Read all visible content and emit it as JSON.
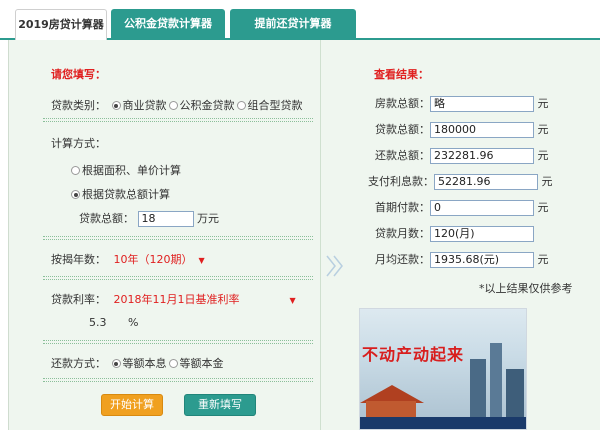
{
  "tabs": [
    {
      "label": "2019房贷计算器",
      "active": true
    },
    {
      "label": "公积金贷款计算器",
      "active": false
    },
    {
      "label": "提前还贷计算器",
      "active": false
    }
  ],
  "form": {
    "heading": "请您填写：",
    "loan_type_label": "贷款类别：",
    "loan_types": [
      "商业贷款",
      "公积金贷款",
      "组合型贷款"
    ],
    "loan_type_selected": "商业贷款",
    "calc_method_label": "计算方式：",
    "calc_options": [
      "根据面积、单价计算",
      "根据贷款总额计算"
    ],
    "calc_selected": "根据贷款总额计算",
    "total_label": "贷款总额：",
    "total_value": "18",
    "total_unit": "万元",
    "years_label": "按揭年数：",
    "years_value": "10年（120期）",
    "rate_label": "贷款利率：",
    "rate_value": "2018年11月1日基准利率",
    "rate_number": "5.3",
    "rate_unit": "%",
    "repay_label": "还款方式：",
    "repay_options": [
      "等额本息",
      "等额本金"
    ],
    "repay_selected": "等额本息",
    "start_button": "开始计算",
    "reset_button": "重新填写"
  },
  "results": {
    "heading": "查看结果：",
    "rows": [
      {
        "label": "房款总额：",
        "value": "略",
        "unit": "元"
      },
      {
        "label": "贷款总额：",
        "value": "180000",
        "unit": "元"
      },
      {
        "label": "还款总额：",
        "value": "232281.96",
        "unit": "元"
      },
      {
        "label": "支付利息款：",
        "value": "52281.96",
        "unit": "元"
      },
      {
        "label": "首期付款：",
        "value": "0",
        "unit": "元"
      },
      {
        "label": "贷款月数：",
        "value": "120(月)",
        "unit": ""
      },
      {
        "label": "月均还款：",
        "value": "1935.68(元)",
        "unit": "元"
      }
    ],
    "note": "*以上结果仅供参考"
  },
  "ad": {
    "title": "不动产动起来"
  },
  "colors": {
    "accent": "#2c9b8f",
    "highlight": "#e02020",
    "panel_bg": "#eff6ef",
    "start_button": "#f0a020"
  },
  "icons": {
    "divider": "double-chevron-right-icon",
    "dropdown": "caret-down-icon"
  }
}
